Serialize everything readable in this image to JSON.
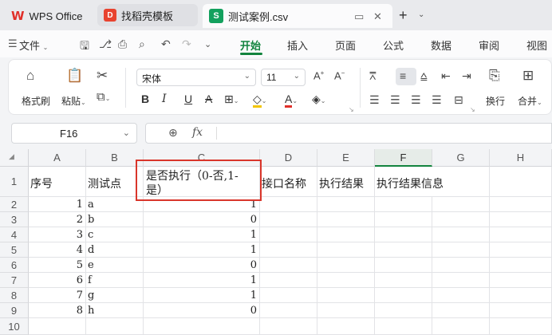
{
  "tabs": [
    {
      "label": "WPS Office",
      "logo": "W"
    },
    {
      "label": "找稻壳模板",
      "logo": "D"
    },
    {
      "label": "测试案例.csv",
      "logo": "S"
    }
  ],
  "menu": {
    "hamburger": "☰",
    "file": "文件",
    "items": [
      "开始",
      "插入",
      "页面",
      "公式",
      "数据",
      "审阅",
      "视图"
    ],
    "active": "开始"
  },
  "ribbon": {
    "format_painter": "格式刷",
    "paste": "粘贴",
    "font_name": "宋体",
    "font_size": "11",
    "wrap": "换行",
    "merge": "合并"
  },
  "formula_bar": {
    "cell_ref": "F16",
    "fx": "fx",
    "content": ""
  },
  "grid": {
    "columns": [
      "A",
      "B",
      "C",
      "D",
      "E",
      "F",
      "G",
      "H"
    ],
    "selected_column": "F",
    "row_numbers": [
      "1",
      "2",
      "3",
      "4",
      "5",
      "6",
      "7",
      "8",
      "9",
      "10"
    ],
    "header_row": {
      "A": "序号",
      "B": "测试点",
      "C_line1": "是否执行（0-否,1-",
      "C_line2": "是）",
      "D": "接口名称",
      "E": "执行结果",
      "F": "执行结果信息"
    },
    "rows": [
      {
        "A": "1",
        "B": "a",
        "C": "1"
      },
      {
        "A": "2",
        "B": "b",
        "C": "0"
      },
      {
        "A": "3",
        "B": "c",
        "C": "1"
      },
      {
        "A": "4",
        "B": "d",
        "C": "1"
      },
      {
        "A": "5",
        "B": "e",
        "C": "0"
      },
      {
        "A": "6",
        "B": "f",
        "C": "1"
      },
      {
        "A": "7",
        "B": "g",
        "C": "1"
      },
      {
        "A": "8",
        "B": "h",
        "C": "0"
      }
    ]
  },
  "colors": {
    "accent": "#12843e",
    "highlight_box": "#d9362b"
  }
}
